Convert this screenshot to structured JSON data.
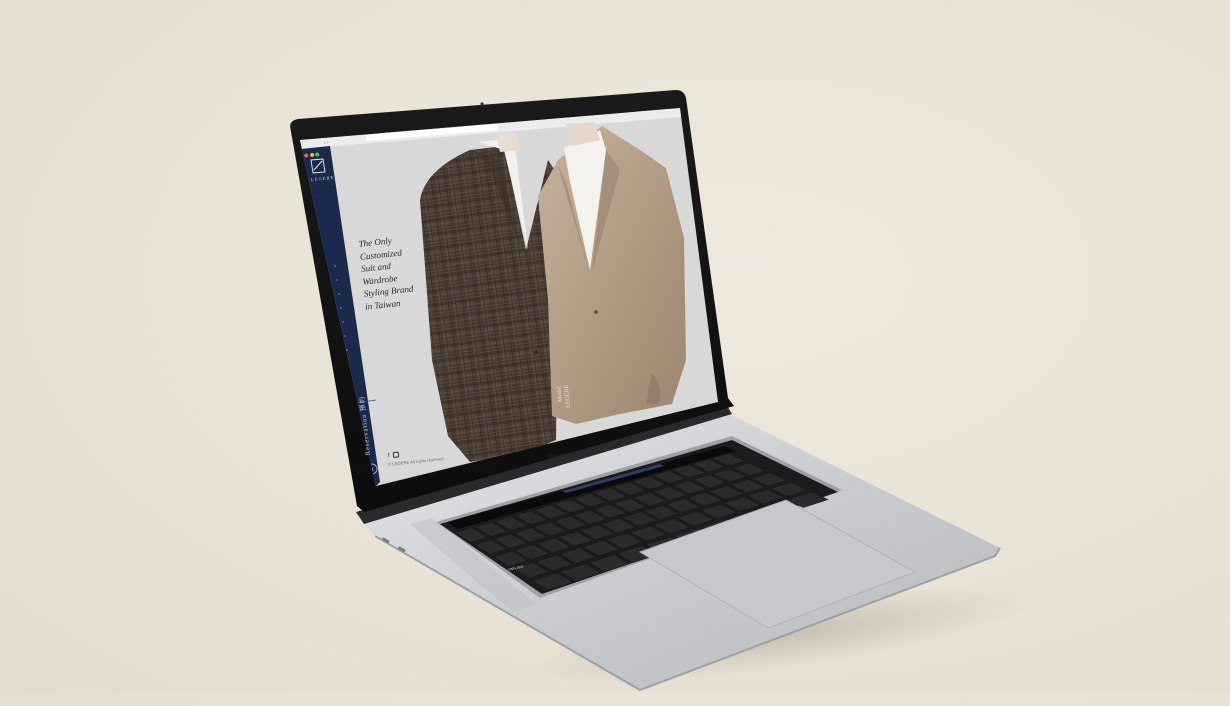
{
  "device": {
    "model_label": "MacBook Pro"
  },
  "browser": {
    "back_icon": "chevron-left-icon",
    "forward_icon": "chevron-right-icon",
    "traffic_light_colors": [
      "#ee5f58",
      "#f6be2f",
      "#3ec846"
    ]
  },
  "site": {
    "brand_name": "LEGERE",
    "tagline_lines": [
      "The Only",
      "Customized",
      "Suit and",
      "Wardrobe",
      "Styling Brand",
      "in Taiwan"
    ],
    "sidebar_nav_dot_count": 7,
    "reservation_label": "Reservation",
    "reservation_sub": "預約",
    "social_icons": [
      "facebook-icon",
      "instagram-icon"
    ],
    "copyright": "© LEGERE All rights reserved",
    "scroll_button_icon": "chevron-up-icon",
    "model_caption_1": "Model",
    "model_caption_2": "LEGERE",
    "colors": {
      "sidebar_navy": "#1b2a4c",
      "hero_background": "#d9d9d9",
      "jacket_plaid": "#4b4036",
      "jacket_camel": "#b29b85"
    }
  },
  "keyboard": {
    "caps_key_label": "caps lock"
  }
}
